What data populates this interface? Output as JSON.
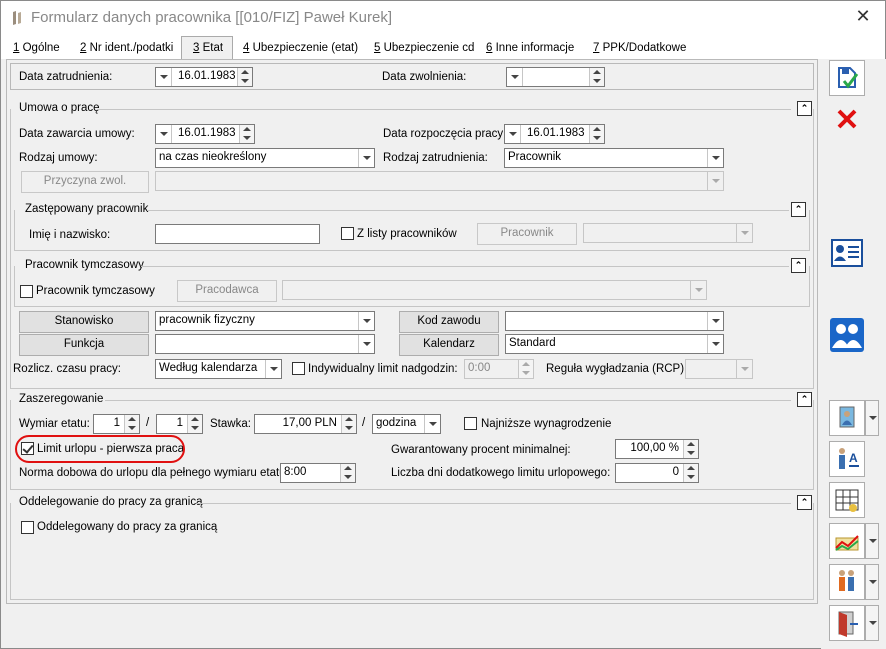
{
  "window": {
    "title": "Formularz danych pracownika [[010/FIZ] Paweł Kurek]"
  },
  "tabs": [
    {
      "num": "1",
      "label": " Ogólne"
    },
    {
      "num": "2",
      "label": " Nr ident./podatki"
    },
    {
      "num": "3",
      "label": " Etat"
    },
    {
      "num": "4",
      "label": " Ubezpieczenie (etat)"
    },
    {
      "num": "5",
      "label": " Ubezpieczenie cd"
    },
    {
      "num": "6",
      "label": " Inne informacje"
    },
    {
      "num": "7",
      "label": " PPK/Dodatkowe"
    }
  ],
  "employment": {
    "hire_date_label": "Data zatrudnienia:",
    "hire_date": "16.01.1983",
    "dismissal_label": "Data zwolnienia:",
    "dismissal_date": ""
  },
  "contract": {
    "section": "Umowa o pracę",
    "signed_label": "Data zawarcia umowy:",
    "signed_date": "16.01.1983",
    "start_label": "Data rozpoczęcia pracy:",
    "start_date": "16.01.1983",
    "type_label": "Rodzaj umowy:",
    "type_value": "na czas nieokreślony",
    "employment_type_label": "Rodzaj zatrudnienia:",
    "employment_type_value": "Pracownik",
    "reason_button": "Przyczyna zwol."
  },
  "replaced": {
    "section": "Zastępowany pracownik",
    "name_label": "Imię i nazwisko:",
    "name_value": "",
    "from_list_label": "Z listy pracowników",
    "employee_button": "Pracownik"
  },
  "temporary": {
    "section": "Pracownik tymczasowy",
    "checkbox_label": "Pracownik tymczasowy",
    "employer_button": "Pracodawca"
  },
  "position": {
    "position_button": "Stanowisko",
    "position_value": "pracownik fizyczny",
    "profession_button": "Kod zawodu",
    "profession_value": "",
    "function_button": "Funkcja",
    "function_value": "",
    "calendar_button": "Kalendarz",
    "calendar_value": "Standard",
    "settlement_label": "Rozlicz. czasu pracy:",
    "settlement_value": "Według kalendarza",
    "overtime_label": "Indywidualny limit nadgodzin:",
    "overtime_value": "0:00",
    "smoothing_label": "Reguła wygładzania (RCP):"
  },
  "grading": {
    "section": "Zaszeregowanie",
    "fte_label": "Wymiar etatu:",
    "fte_num": "1",
    "fte_sep": "/",
    "fte_den": "1",
    "rate_label": "Stawka:",
    "rate_value": "17,00 PLN",
    "rate_sep": "/",
    "rate_unit": "godzina",
    "min_wage_label": "Najniższe wynagrodzenie",
    "leave_limit_label": "Limit urlopu - pierwsza praca",
    "guaranteed_label": "Gwarantowany procent minimalnej:",
    "guaranteed_value": "100,00 %",
    "daily_norm_label": "Norma dobowa do urlopu dla pełnego wymiaru etatu:",
    "daily_norm_value": "8:00",
    "extra_days_label": "Liczba dni dodatkowego limitu urlopowego:",
    "extra_days_value": "0"
  },
  "abroad": {
    "section": "Oddelegowanie do pracy za granicą",
    "checkbox_label": "Oddelegowany do pracy za granicą"
  },
  "colors": {
    "accent_blue": "#1a4f9c",
    "danger_red": "#e01010",
    "highlight": "#e01010"
  }
}
